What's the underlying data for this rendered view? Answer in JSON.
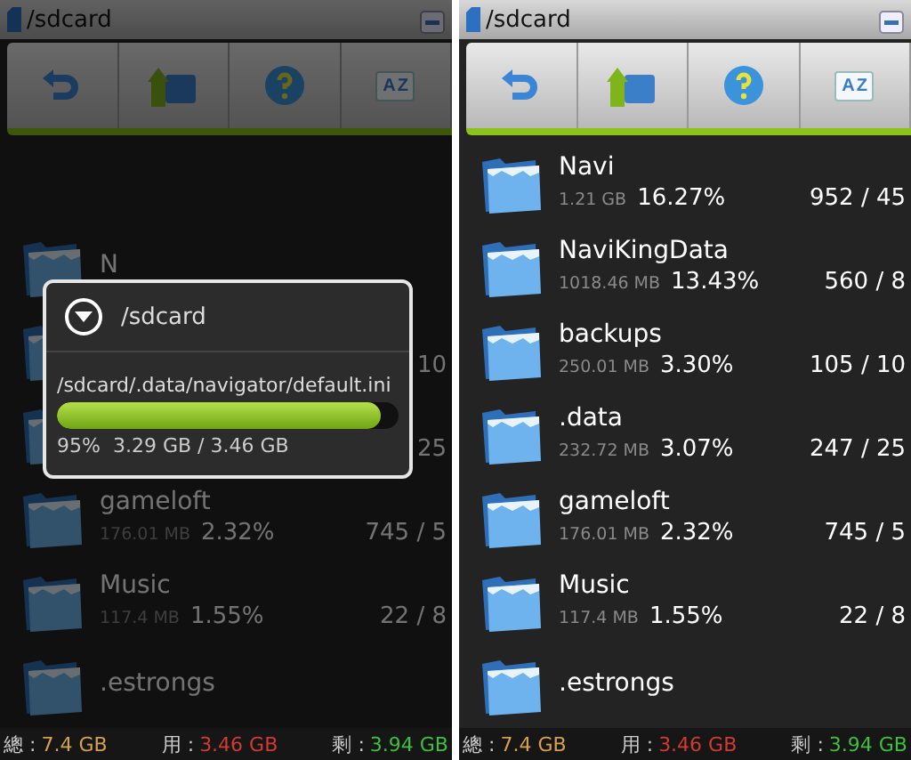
{
  "screens": [
    {
      "title": "/sdcard",
      "dimmed": true,
      "sort_icon_letters": [
        "A",
        "Z"
      ],
      "rows": [
        {
          "kind": "blank"
        },
        {
          "kind": "folder",
          "name": "N"
        },
        {
          "kind": "folder",
          "count": "10"
        },
        {
          "kind": "folder",
          "count": "25"
        },
        {
          "kind": "folder",
          "name": "gameloft",
          "size": "176.01 MB",
          "percent": "2.32%",
          "count": "745 / 5"
        },
        {
          "kind": "folder",
          "name": "Music",
          "size": "117.4 MB",
          "percent": "1.55%",
          "count": "22 / 8"
        },
        {
          "kind": "folder",
          "name": ".estrongs"
        }
      ],
      "dialog": {
        "title": "/sdcard",
        "path": "/sdcard/.data/navigator/default.ini",
        "level": 0.95,
        "percent": "95%",
        "amount": "3.29 GB / 3.46 GB"
      },
      "footer": [
        {
          "label": "總 :",
          "value": "7.4 GB",
          "color": "#d6a050"
        },
        {
          "label": "用 :",
          "value": "3.46 GB",
          "color": "#d23a32"
        },
        {
          "label": "剩 :",
          "value": "3.94 GB",
          "color": "#3fbf3f"
        }
      ]
    },
    {
      "title": "/sdcard",
      "dimmed": false,
      "sort_icon_letters": [
        "A",
        "Z"
      ],
      "rows": [
        {
          "kind": "folder",
          "name": "Navi",
          "size": "1.21 GB",
          "percent": "16.27%",
          "count": "952 / 45"
        },
        {
          "kind": "folder",
          "name": "NaviKingData",
          "size": "1018.46 MB",
          "percent": "13.43%",
          "count": "560 / 8"
        },
        {
          "kind": "folder",
          "name": "backups",
          "size": "250.01 MB",
          "percent": "3.30%",
          "count": "105 / 10"
        },
        {
          "kind": "folder",
          "name": ".data",
          "size": "232.72 MB",
          "percent": "3.07%",
          "count": "247 / 25"
        },
        {
          "kind": "folder",
          "name": "gameloft",
          "size": "176.01 MB",
          "percent": "2.32%",
          "count": "745 / 5"
        },
        {
          "kind": "folder",
          "name": "Music",
          "size": "117.4 MB",
          "percent": "1.55%",
          "count": "22 / 8"
        },
        {
          "kind": "folder",
          "name": ".estrongs"
        }
      ],
      "footer": [
        {
          "label": "總 :",
          "value": "7.4 GB",
          "color": "#d6a050"
        },
        {
          "label": "用 :",
          "value": "3.46 GB",
          "color": "#d23a32"
        },
        {
          "label": "剩 :",
          "value": "3.94 GB",
          "color": "#3fbf3f"
        }
      ]
    }
  ]
}
